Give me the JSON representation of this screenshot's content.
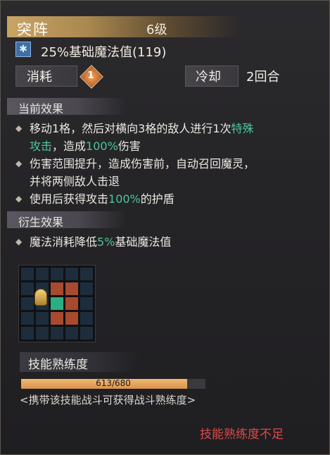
{
  "skill": {
    "name": "突阵",
    "level": "6级",
    "cost_text": "25%基础魔法值(119)"
  },
  "stats": {
    "consume_label": "消耗",
    "consume_value": "1",
    "cooldown_label": "冷却",
    "cooldown_value": "2回合"
  },
  "current_effects": {
    "title": "当前效果",
    "items": [
      {
        "line1_a": "移动1格，然后对横向3格的敌人进行1次",
        "line1_hl": "特殊",
        "line2_hl": "攻击",
        "line2_a": "，造成",
        "line2_hl2": "100%",
        "line2_b": "伤害"
      },
      {
        "line1_a": "伤害范围提升，造成伤害前，自动召回魔灵，",
        "line2_a": "并将两侧敌人击退"
      },
      {
        "line1_a": "使用后获得攻击",
        "line1_hl": "100%",
        "line1_b": "的护盾"
      }
    ]
  },
  "derived_effects": {
    "title": "衍生效果",
    "items": [
      {
        "a": "魔法消耗降低",
        "hl": "5%",
        "b": "基础魔法值"
      }
    ]
  },
  "proficiency": {
    "label": "技能熟练度",
    "value_text": "613/680",
    "fraction": 0.9015,
    "hint": "<携带该技能战斗可获得战斗熟练度>",
    "warning": "技能熟练度不足"
  },
  "colors": {
    "highlight": "#4cc79a",
    "warning": "#d94b48",
    "bar_fill": "#e8a760",
    "grid_red": "#a84a30",
    "grid_green": "#2cae83"
  },
  "range_grid": {
    "size": 5,
    "red_cells": [
      [
        1,
        2
      ],
      [
        1,
        3
      ],
      [
        2,
        3
      ],
      [
        3,
        2
      ],
      [
        3,
        3
      ]
    ],
    "green_cells": [
      [
        2,
        2
      ]
    ],
    "hero_cell": [
      2,
      1
    ]
  }
}
